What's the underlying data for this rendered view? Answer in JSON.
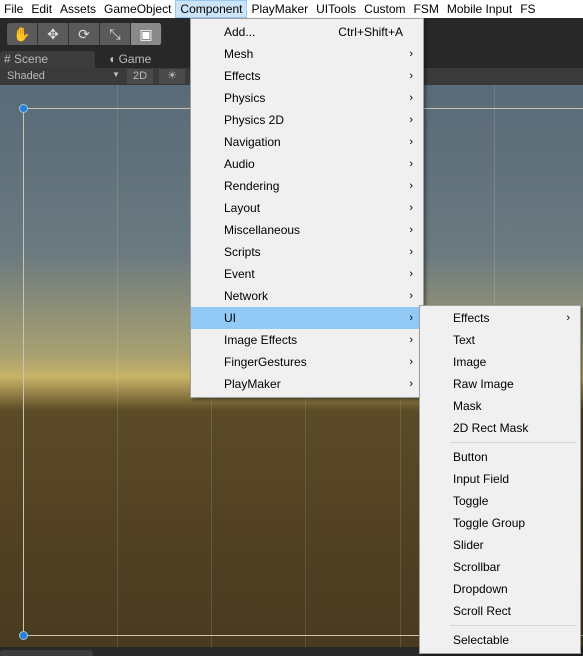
{
  "menubar": [
    "File",
    "Edit",
    "Assets",
    "GameObject",
    "Component",
    "PlayMaker",
    "UITools",
    "Custom",
    "FSM",
    "Mobile Input",
    "FS"
  ],
  "tools": [
    "hand-icon",
    "move-icon",
    "rotate-icon",
    "scale-icon",
    "rect-tool-icon"
  ],
  "tabs": {
    "scene": "Scene",
    "game": "Game"
  },
  "scenebar": {
    "shading": "Shaded",
    "mode2d": "2D",
    "lighting": "☀"
  },
  "component_menu": [
    {
      "label": "Add...",
      "shortcut": "Ctrl+Shift+A"
    },
    {
      "label": "Mesh",
      "sub": true
    },
    {
      "label": "Effects",
      "sub": true
    },
    {
      "label": "Physics",
      "sub": true
    },
    {
      "label": "Physics 2D",
      "sub": true
    },
    {
      "label": "Navigation",
      "sub": true
    },
    {
      "label": "Audio",
      "sub": true
    },
    {
      "label": "Rendering",
      "sub": true
    },
    {
      "label": "Layout",
      "sub": true
    },
    {
      "label": "Miscellaneous",
      "sub": true
    },
    {
      "label": "Scripts",
      "sub": true
    },
    {
      "label": "Event",
      "sub": true
    },
    {
      "label": "Network",
      "sub": true
    },
    {
      "label": "UI",
      "sub": true,
      "highlighted": true
    },
    {
      "label": "Image Effects",
      "sub": true
    },
    {
      "label": "FingerGestures",
      "sub": true
    },
    {
      "label": "PlayMaker",
      "sub": true
    }
  ],
  "ui_menu": [
    [
      {
        "label": "Effects",
        "sub": true
      },
      {
        "label": "Text"
      },
      {
        "label": "Image"
      },
      {
        "label": "Raw Image"
      },
      {
        "label": "Mask"
      },
      {
        "label": "2D Rect Mask"
      }
    ],
    [
      {
        "label": "Button"
      },
      {
        "label": "Input Field"
      },
      {
        "label": "Toggle"
      },
      {
        "label": "Toggle Group"
      },
      {
        "label": "Slider"
      },
      {
        "label": "Scrollbar"
      },
      {
        "label": "Dropdown"
      },
      {
        "label": "Scroll Rect"
      }
    ],
    [
      {
        "label": "Selectable"
      }
    ]
  ],
  "colors": {
    "highlight": "#91c9f7",
    "menubar_active": "#cce4f7",
    "handle": "#2a7ce0"
  }
}
